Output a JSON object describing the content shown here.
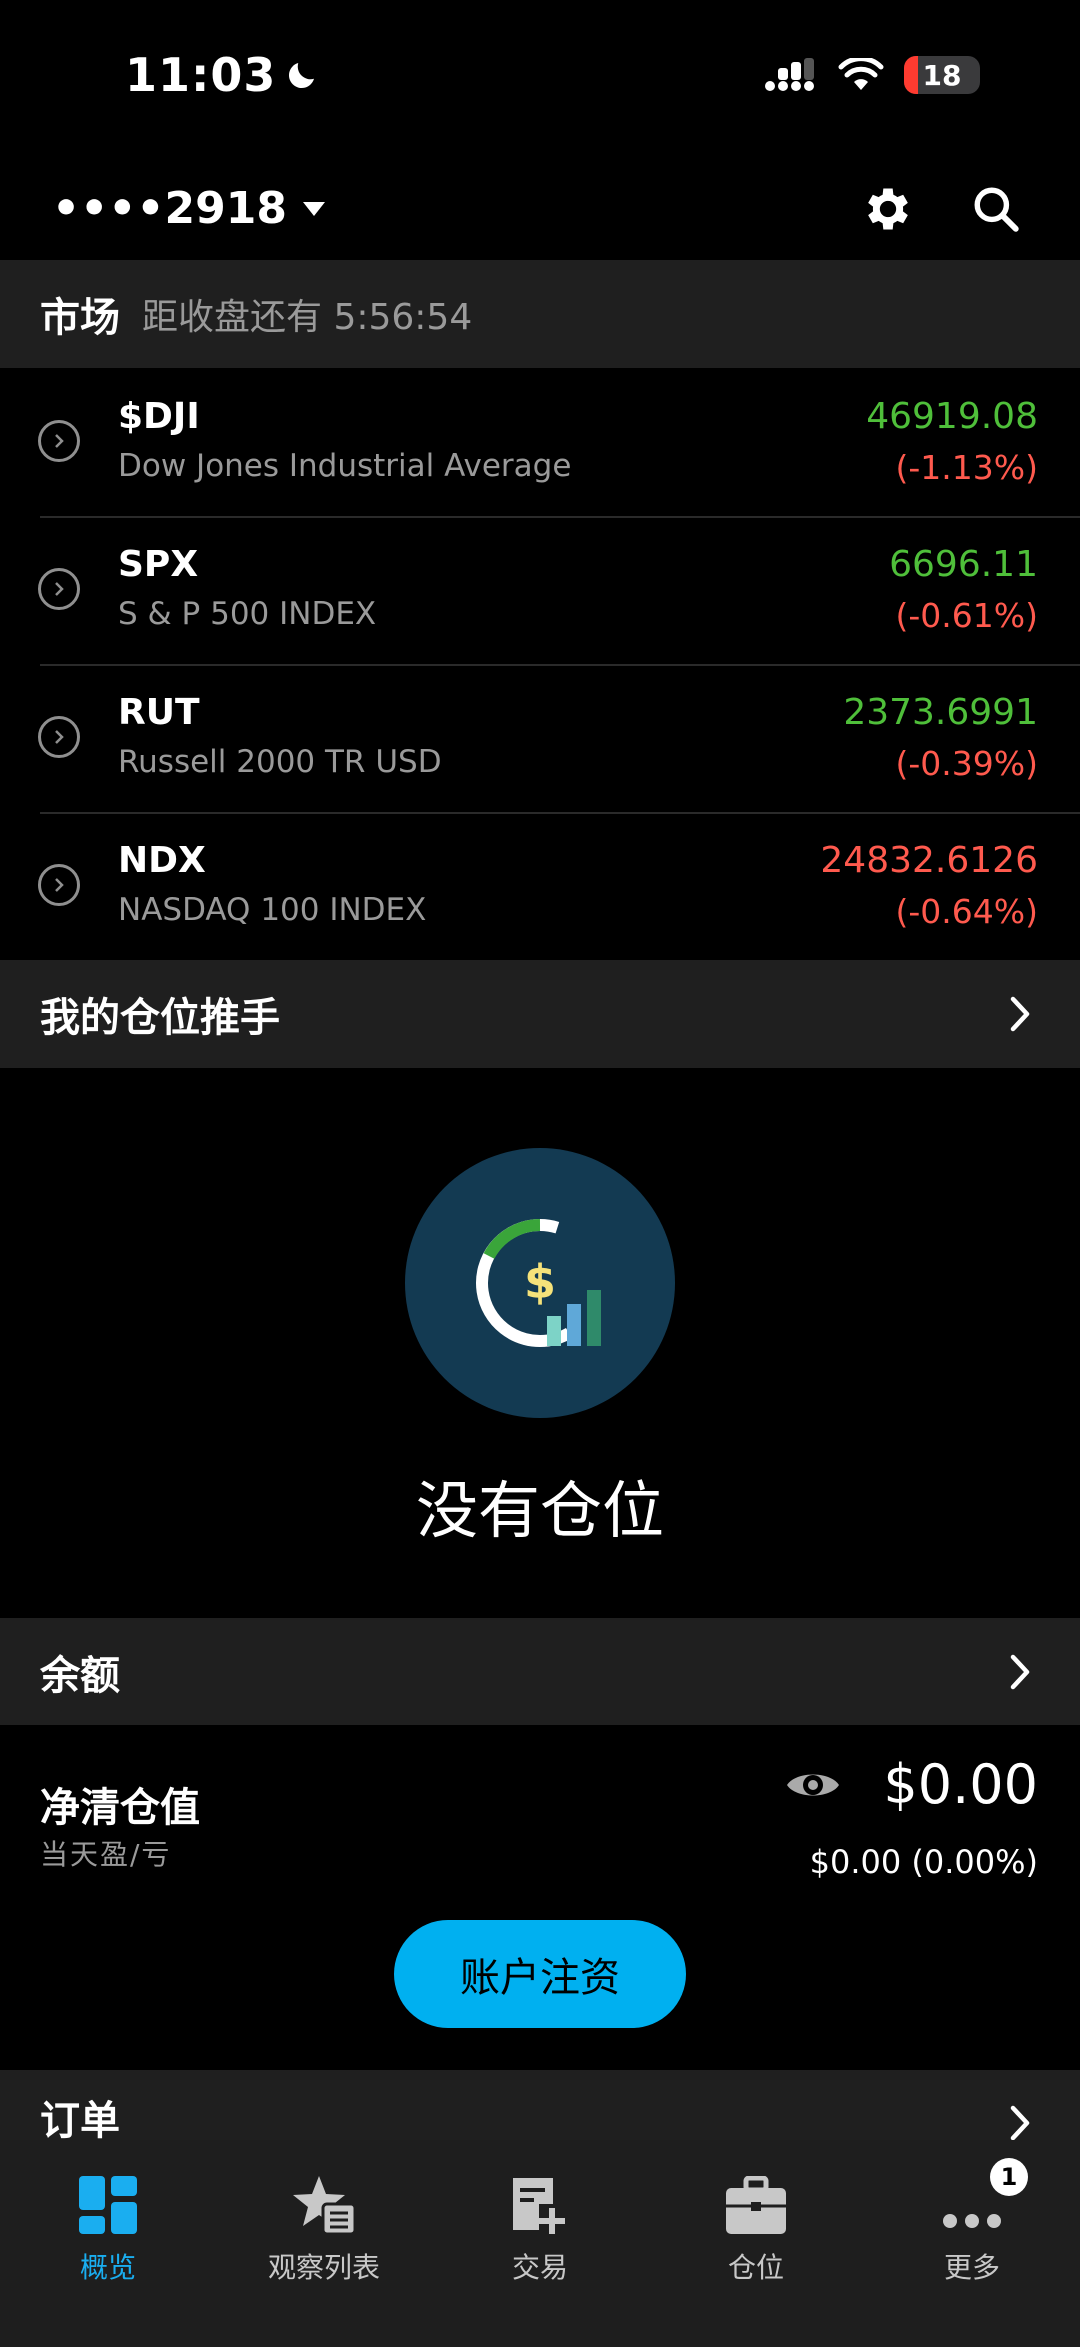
{
  "status_bar": {
    "time": "11:03",
    "battery": "18"
  },
  "header": {
    "account": "••••2918"
  },
  "market": {
    "title": "市场",
    "countdown": "距收盘还有 5:56:54",
    "items": [
      {
        "symbol": "$DJI",
        "name": "Dow Jones Industrial Average",
        "price": "46919.08",
        "change": "(-1.13%)",
        "price_color": "green"
      },
      {
        "symbol": "SPX",
        "name": "S & P 500 INDEX",
        "price": "6696.11",
        "change": "(-0.61%)",
        "price_color": "green"
      },
      {
        "symbol": "RUT",
        "name": "Russell 2000 TR USD",
        "price": "2373.6991",
        "change": "(-0.39%)",
        "price_color": "green"
      },
      {
        "symbol": "NDX",
        "name": "NASDAQ 100 INDEX",
        "price": "24832.6126",
        "change": "(-0.64%)",
        "price_color": "red"
      }
    ]
  },
  "positions_pusher": {
    "title": "我的仓位推手"
  },
  "empty_positions": {
    "message": "没有仓位"
  },
  "balance": {
    "title": "余额"
  },
  "net_value": {
    "label": "净清仓值",
    "sublabel": "当天盈/亏",
    "value": "$0.00",
    "day_pl": "$0.00 (0.00%)",
    "deposit_button": "账户注资"
  },
  "orders": {
    "title": "订单"
  },
  "tabbar": {
    "tabs": [
      {
        "label": "概览",
        "icon": "overview-icon",
        "active": true
      },
      {
        "label": "观察列表",
        "icon": "watchlist-icon"
      },
      {
        "label": "交易",
        "icon": "trade-icon"
      },
      {
        "label": "仓位",
        "icon": "positions-icon"
      },
      {
        "label": "更多",
        "icon": "more-icon",
        "badge": "1"
      }
    ]
  },
  "colors": {
    "accent": "#1aaef0",
    "up": "#4fbf3a",
    "down": "#ff5a4e",
    "section_bg": "#1f1f1f"
  }
}
